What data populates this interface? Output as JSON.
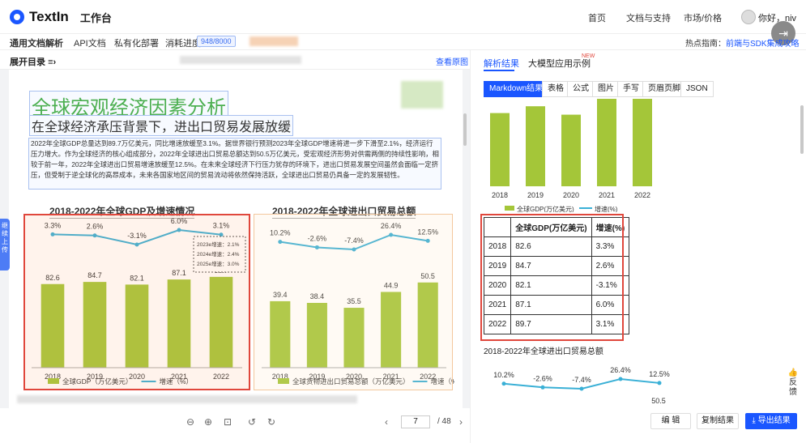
{
  "topbar": {
    "logo_text": "TextIn",
    "logo_sub": "工作台",
    "nav": [
      "首页",
      "文档与支持",
      "市场/价格"
    ],
    "greeting": "你好，",
    "user_name": "niv"
  },
  "subbar": {
    "items": [
      "通用文档解析",
      "API文档",
      "私有化部署",
      "消耗进度"
    ],
    "usage": "948/8000",
    "hint_label": "热点指南：",
    "hint_link": "前端与SDK集成攻略"
  },
  "leftbar": {
    "expand": "展开目录",
    "view_original": "查看原图"
  },
  "doc": {
    "title": "全球宏观经济因素分析",
    "subtitle": "在全球经济承压背景下，进出口贸易发展放缓",
    "para": "2022年全球GDP总量达到89.7万亿美元，同比增速放缓至3.1%。据世界银行预测2023年全球GDP增速将进一步下滑至2.1%，经济运行压力增大。作为全球经济的核心组成部分，2022年全球进出口贸易总额达到50.5万亿美元，受宏观经济形势对供需两侧的持续性影响，相较于前一年，2022年全球进出口贸易增速放缓至12.5%。在未来全球经济下行压力犹存的环境下，进出口贸易发展空间虽然会面临一定挤压，但受制于逆全球化的高昂成本，未来各国家地区间的贸易流动将依然保持活跃，全球进出口贸易仍具备一定的发展韧性。",
    "source_note": "[C]全球进出口贸易流动..."
  },
  "side_tab": "继续上传",
  "pager": {
    "current": "7",
    "total": "/ 48"
  },
  "right": {
    "tabs": [
      "解析结果",
      "大模型应用示例"
    ],
    "new_badge": "NEW",
    "formats": [
      "Markdown结果",
      "表格",
      "公式",
      "图片",
      "手写",
      "页眉页脚",
      "JSON"
    ],
    "table_headers": [
      "",
      "全球GDP(万亿美元)",
      "增速(%)"
    ],
    "table_rows": [
      [
        "2018",
        "82.6",
        "3.3%"
      ],
      [
        "2019",
        "84.7",
        "2.6%"
      ],
      [
        "2020",
        "82.1",
        "-3.1%"
      ],
      [
        "2021",
        "87.1",
        "6.0%"
      ],
      [
        "2022",
        "89.7",
        "3.1%"
      ]
    ],
    "trade_caption": "2018-2022年全球进出口贸易总额",
    "buttons": {
      "edit": "编 辑",
      "copy": "复制结果",
      "export": "导出结果"
    },
    "feedback": "反馈"
  },
  "chart_data": [
    {
      "type": "bar",
      "title": "2018-2022年全球GDP及增速情况",
      "categories": [
        "2018",
        "2019",
        "2020",
        "2021",
        "2022"
      ],
      "series": [
        {
          "name": "全球GDP（万亿美元）",
          "values": [
            82.6,
            84.7,
            82.1,
            87.1,
            89.7
          ]
        },
        {
          "name": "增速（%）",
          "type": "line",
          "values": [
            3.3,
            2.6,
            -3.1,
            6.0,
            3.1
          ]
        }
      ],
      "value_labels": [
        "82.6",
        "84.7",
        "82.1",
        "87.1",
        "89.7"
      ],
      "rate_labels": [
        "3.3%",
        "2.6%",
        "-3.1%",
        "6.0%",
        "3.1%"
      ],
      "forecast": [
        "2023e增速：2.1%",
        "2024e增速：2.4%",
        "2025e增速：3.0%"
      ],
      "colors": {
        "bar": "#a4c639",
        "line": "#3ab0d6"
      },
      "ylim": [
        0,
        100
      ]
    },
    {
      "type": "bar",
      "title": "2018-2022年全球进出口贸易总额",
      "categories": [
        "2018",
        "2019",
        "2020",
        "2021",
        "2022"
      ],
      "series": [
        {
          "name": "全球货物进出口贸易总额（万亿美元）",
          "values": [
            39.4,
            38.4,
            35.5,
            44.9,
            50.5
          ]
        },
        {
          "name": "增速（%）",
          "type": "line",
          "values": [
            10.2,
            -2.6,
            -7.4,
            26.4,
            12.5
          ]
        }
      ],
      "value_labels": [
        "39.4",
        "38.4",
        "35.5",
        "44.9",
        "50.5"
      ],
      "rate_labels": [
        "10.2%",
        "-2.6%",
        "-7.4%",
        "26.4%",
        "12.5%"
      ],
      "colors": {
        "bar": "#a4c639",
        "line": "#3ab0d6"
      },
      "ylim": [
        0,
        60
      ]
    },
    {
      "type": "bar",
      "title": "",
      "categories": [
        "2018",
        "2019",
        "2020",
        "2021",
        "2022"
      ],
      "series": [
        {
          "name": "全球GDP(万亿美元)",
          "values": [
            82.6,
            84.7,
            82.1,
            87.1,
            89.7
          ]
        },
        {
          "name": "增速(%)",
          "type": "line",
          "values": [
            3.3,
            2.6,
            -3.1,
            6.0,
            3.1
          ]
        }
      ],
      "legend": [
        "全球GDP(万亿美元)",
        "增速(%)"
      ]
    },
    {
      "type": "line",
      "title": "2018-2022年全球进出口贸易总额",
      "categories": [
        "2018",
        "2019",
        "2020",
        "2021",
        "2022"
      ],
      "values": [
        10.2,
        -2.6,
        -7.4,
        26.4,
        12.5
      ],
      "labels": [
        "10.2%",
        "-2.6%",
        "-7.4%",
        "26.4%",
        "12.5%"
      ],
      "extra_label": "50.5"
    }
  ]
}
